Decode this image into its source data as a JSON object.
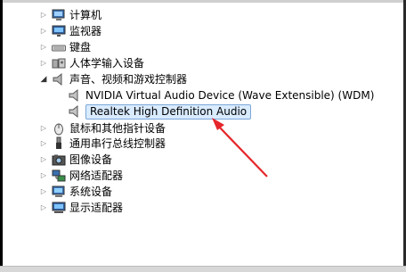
{
  "tree": {
    "computer": "计算机",
    "monitors": "监视器",
    "keyboards": "键盘",
    "hid": "人体学输入设备",
    "sound": "声音、视频和游戏控制器",
    "nvidia_audio": "NVIDIA Virtual Audio Device (Wave Extensible) (WDM)",
    "realtek_audio": "Realtek High Definition Audio",
    "mice": "鼠标和其他指针设备",
    "usb": "通用串行总线控制器",
    "imaging": "图像设备",
    "network": "网络适配器",
    "system": "系统设备",
    "display": "显示适配器"
  },
  "colors": {
    "annotation_arrow": "#e5262b",
    "selection_bg": "#d9ebff",
    "selection_border": "#7aa7d9"
  },
  "icons": {
    "computer": "computer-icon",
    "monitors": "monitor-icon",
    "keyboards": "keyboard-icon",
    "hid": "hid-icon",
    "sound": "speaker-icon",
    "mice": "mouse-icon",
    "usb": "usb-icon",
    "imaging": "camera-icon",
    "network": "network-icon",
    "system": "system-icon",
    "display": "display-adapter-icon"
  }
}
